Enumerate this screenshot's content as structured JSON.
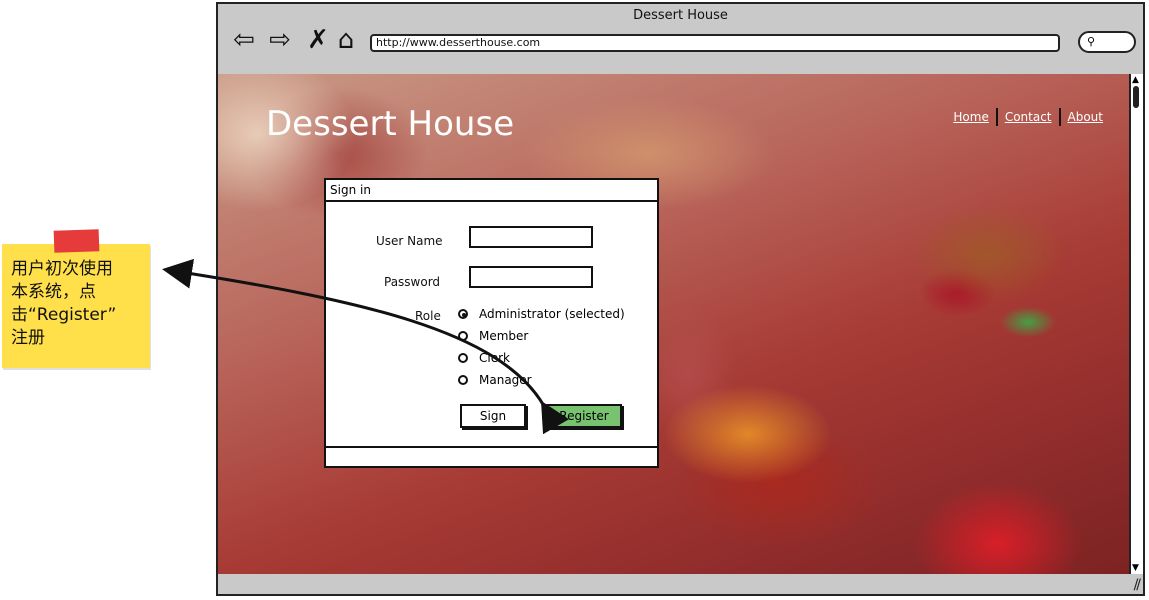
{
  "window": {
    "title": "Dessert House",
    "url": "http://www.desserthouse.com"
  },
  "toolbar": {
    "icons": [
      "back-icon",
      "forward-icon",
      "close-icon",
      "home-icon"
    ],
    "search_icon": "search-icon"
  },
  "site": {
    "title": "Dessert House",
    "nav": [
      "Home",
      "Contact",
      "About"
    ]
  },
  "signin": {
    "title": "Sign in",
    "username_label": "User Name",
    "password_label": "Password",
    "role_label": "Role",
    "roles": [
      "Administrator (selected)",
      "Member",
      "Clerk",
      "Manager"
    ],
    "selected_role_index": 0,
    "sign_button": "Sign",
    "register_button": "Register"
  },
  "note": {
    "lines": [
      "用户初次使用",
      "本系统，点",
      "击“Register”",
      "注册"
    ]
  },
  "colors": {
    "sticky": "#ffe04a",
    "sticky_tape": "#e53b3b",
    "register_button": "#79c270",
    "browser_chrome": "#c9c9c9"
  }
}
